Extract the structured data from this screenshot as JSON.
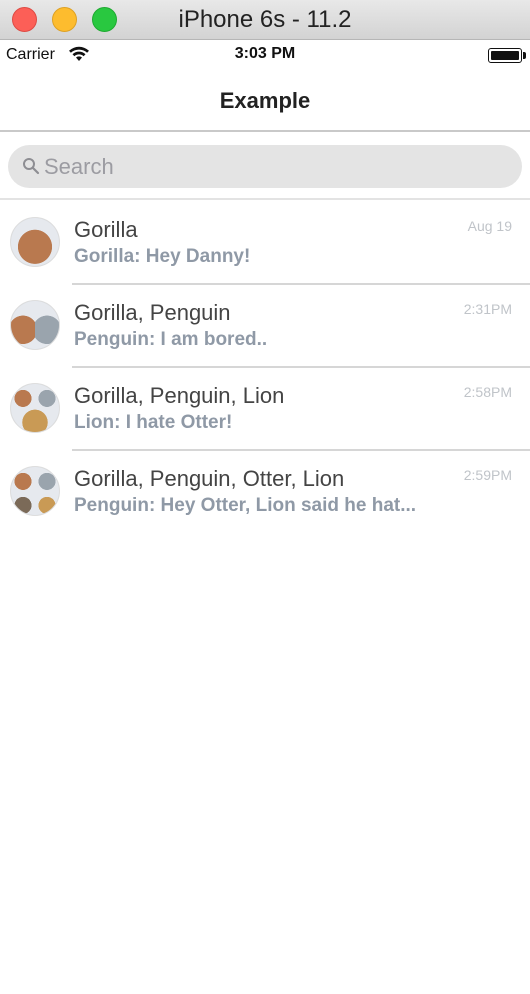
{
  "window": {
    "title": "iPhone 6s - 11.2"
  },
  "status_bar": {
    "carrier": "Carrier",
    "time": "3:03 PM"
  },
  "nav": {
    "title": "Example"
  },
  "search": {
    "placeholder": "Search"
  },
  "conversations": [
    {
      "name": "Gorilla",
      "preview": "Gorilla: Hey Danny!",
      "time": "Aug 19",
      "avatar": [
        "gorilla"
      ]
    },
    {
      "name": "Gorilla, Penguin",
      "preview": "Penguin: I am bored..",
      "time": "2:31PM",
      "avatar": [
        "gorilla",
        "penguin"
      ]
    },
    {
      "name": "Gorilla, Penguin, Lion",
      "preview": "Lion: I hate Otter!",
      "time": "2:58PM",
      "avatar": [
        "gorilla",
        "penguin",
        "lion"
      ]
    },
    {
      "name": "Gorilla, Penguin, Otter, Lion",
      "preview": "Penguin: Hey Otter, Lion said he hat...",
      "time": "2:59PM",
      "avatar": [
        "gorilla",
        "penguin",
        "otter",
        "lion"
      ]
    }
  ],
  "colors": {
    "gorilla": "#b9794f",
    "penguin": "#9aa4ad",
    "otter": "#7b6a58",
    "lion": "#c99a55"
  }
}
